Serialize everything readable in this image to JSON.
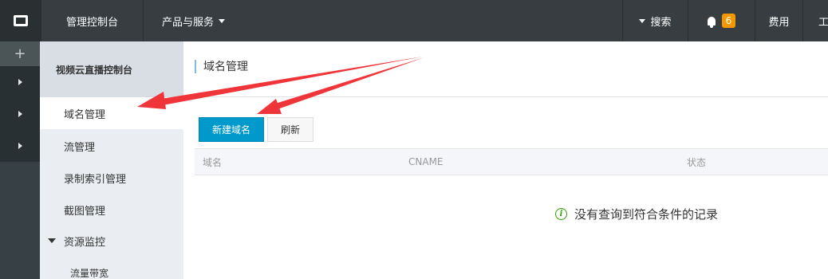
{
  "header": {
    "console_title": "管理控制台",
    "products_label": "产品与服务",
    "search_label": "搜索",
    "notification_count": "6",
    "fee_label": "费用",
    "work_label": "工"
  },
  "rail": {
    "add_symbol": "+"
  },
  "sidebar": {
    "title": "视频云直播控制台",
    "items": [
      {
        "label": "域名管理",
        "active": true
      },
      {
        "label": "流管理"
      },
      {
        "label": "录制索引管理"
      },
      {
        "label": "截图管理"
      },
      {
        "label": "资源监控",
        "expanded": true
      },
      {
        "label": "流量带宽"
      }
    ]
  },
  "main": {
    "page_title": "域名管理",
    "new_domain_button": "新建域名",
    "refresh_button": "刷新",
    "table_columns": [
      "域名",
      "CNAME",
      "状态"
    ],
    "empty_message": "没有查询到符合条件的记录",
    "info_glyph": "i"
  },
  "colors": {
    "topbar": "#373d41",
    "primary": "#0099cc",
    "badge": "#f39800",
    "annotation_arrow": "#f0353a"
  }
}
